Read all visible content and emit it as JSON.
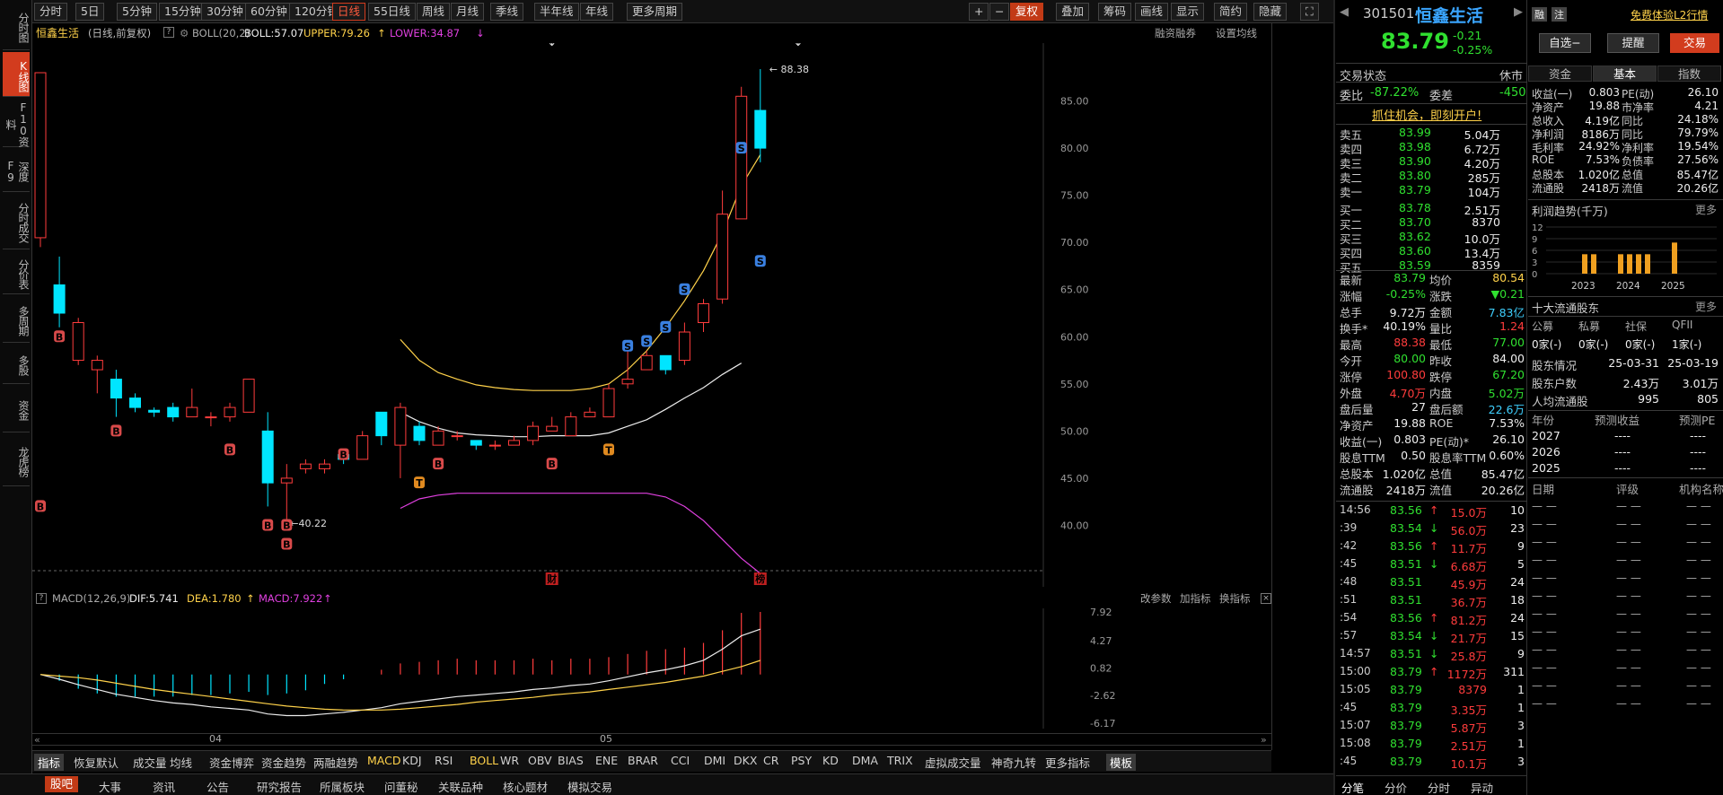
{
  "left_tabs": [
    "分时图",
    "K线图",
    "F10资料",
    "深度F9",
    "分时成交",
    "分价表",
    "多周期",
    "多股",
    "资金",
    "龙虎榜"
  ],
  "toolbar": {
    "periods": [
      "分时",
      "5日",
      "5分钟",
      "15分钟",
      "30分钟",
      "60分钟",
      "120分钟",
      "日线",
      "55日线",
      "周线",
      "月线",
      "季线",
      "半年线",
      "年线",
      "更多周期"
    ],
    "active_period": "日线",
    "right_tools": [
      "+",
      "−",
      "复权",
      "叠加",
      "筹码",
      "画线",
      "显示",
      "简约",
      "隐藏"
    ]
  },
  "chart_header": {
    "name": "恒鑫生活",
    "mode": "(日线,前复权)",
    "indicator": "BOLL(20,2)",
    "boll": "BOLL:57.07",
    "upper": "UPPER:79.26",
    "lower": "LOWER:34.87",
    "links": [
      "融资融券",
      "设置均线"
    ]
  },
  "chart_data": [
    {
      "type": "candlestick",
      "title": "恒鑫生活 日线 前复权",
      "ylim": [
        35,
        90
      ],
      "ticks": [
        40,
        45,
        50,
        55,
        60,
        65,
        70,
        75,
        80,
        85
      ],
      "candles": [
        {
          "o": 70.5,
          "c": 88.0,
          "h": 88.0,
          "l": 69.5
        },
        {
          "o": 65.5,
          "c": 62.5,
          "h": 68.5,
          "l": 61.0
        },
        {
          "o": 57.5,
          "c": 61.5,
          "h": 62.0,
          "l": 57.0
        },
        {
          "o": 56.5,
          "c": 57.5,
          "h": 58.0,
          "l": 54.0
        },
        {
          "o": 55.5,
          "c": 53.5,
          "h": 56.5,
          "l": 51.5
        },
        {
          "o": 53.5,
          "c": 52.5,
          "h": 54.0,
          "l": 52.0
        },
        {
          "o": 52.2,
          "c": 52.0,
          "h": 52.5,
          "l": 51.5
        },
        {
          "o": 52.5,
          "c": 51.5,
          "h": 53.0,
          "l": 51.0
        },
        {
          "o": 51.5,
          "c": 52.5,
          "h": 54.5,
          "l": 51.5
        },
        {
          "o": 51.5,
          "c": 51.5,
          "h": 52.0,
          "l": 50.5
        },
        {
          "o": 51.5,
          "c": 52.5,
          "h": 53.0,
          "l": 51.0
        },
        {
          "o": 52.0,
          "c": 55.5,
          "h": 55.5,
          "l": 52.0
        },
        {
          "o": 50.0,
          "c": 44.5,
          "h": 52.0,
          "l": 42.0
        },
        {
          "o": 44.5,
          "c": 45.0,
          "h": 46.5,
          "l": 40.2
        },
        {
          "o": 46.0,
          "c": 46.5,
          "h": 47.0,
          "l": 45.5
        },
        {
          "o": 46.0,
          "c": 46.5,
          "h": 47.0,
          "l": 45.5
        },
        {
          "o": 47.5,
          "c": 47.0,
          "h": 47.5,
          "l": 46.5
        },
        {
          "o": 47.0,
          "c": 49.5,
          "h": 50.0,
          "l": 47.0
        },
        {
          "o": 52.0,
          "c": 49.5,
          "h": 52.0,
          "l": 48.5
        },
        {
          "o": 48.5,
          "c": 52.5,
          "h": 53.0,
          "l": 45.0
        },
        {
          "o": 50.5,
          "c": 49.0,
          "h": 51.0,
          "l": 48.5
        },
        {
          "o": 48.5,
          "c": 50.0,
          "h": 50.5,
          "l": 48.5
        },
        {
          "o": 49.5,
          "c": 49.5,
          "h": 50.0,
          "l": 49.0
        },
        {
          "o": 49.0,
          "c": 48.5,
          "h": 49.0,
          "l": 48.0
        },
        {
          "o": 48.5,
          "c": 48.5,
          "h": 49.0,
          "l": 48.0
        },
        {
          "o": 48.5,
          "c": 49.0,
          "h": 49.5,
          "l": 48.5
        },
        {
          "o": 49.0,
          "c": 50.5,
          "h": 51.0,
          "l": 48.5
        },
        {
          "o": 50.0,
          "c": 50.5,
          "h": 51.5,
          "l": 50.0
        },
        {
          "o": 49.5,
          "c": 51.5,
          "h": 52.0,
          "l": 49.5
        },
        {
          "o": 51.5,
          "c": 52.0,
          "h": 52.5,
          "l": 51.5
        },
        {
          "o": 51.5,
          "c": 54.5,
          "h": 55.0,
          "l": 51.5
        },
        {
          "o": 55.0,
          "c": 55.5,
          "h": 58.5,
          "l": 54.5
        },
        {
          "o": 56.5,
          "c": 58.0,
          "h": 58.5,
          "l": 56.5
        },
        {
          "o": 58.0,
          "c": 56.5,
          "h": 58.0,
          "l": 56.0
        },
        {
          "o": 57.5,
          "c": 60.5,
          "h": 61.5,
          "l": 57.0
        },
        {
          "o": 61.5,
          "c": 63.5,
          "h": 64.0,
          "l": 60.5
        },
        {
          "o": 64.0,
          "c": 73.0,
          "h": 75.5,
          "l": 63.5
        },
        {
          "o": 72.5,
          "c": 85.5,
          "h": 86.5,
          "l": 72.5
        },
        {
          "o": 84.0,
          "c": 80.0,
          "h": 88.38,
          "l": 78.5
        }
      ],
      "boll_mid": [
        null,
        null,
        null,
        null,
        null,
        null,
        null,
        null,
        null,
        null,
        null,
        null,
        null,
        null,
        null,
        null,
        null,
        null,
        null,
        52.0,
        51.0,
        50.3,
        49.8,
        49.6,
        49.5,
        49.4,
        49.4,
        49.5,
        49.5,
        49.5,
        49.8,
        50.5,
        51.2,
        52.3,
        53.5,
        54.6,
        56.0,
        57.2
      ],
      "boll_upper": [
        null,
        null,
        null,
        null,
        null,
        null,
        null,
        null,
        null,
        null,
        null,
        null,
        null,
        null,
        null,
        null,
        null,
        null,
        null,
        59.7,
        57.5,
        56.2,
        55.5,
        54.9,
        54.6,
        54.4,
        54.3,
        54.3,
        54.3,
        54.5,
        55.0,
        56.5,
        58.5,
        61.0,
        63.8,
        67.0,
        71.0,
        76.0,
        79.3
      ],
      "boll_lower": [
        null,
        null,
        null,
        null,
        null,
        null,
        null,
        null,
        null,
        null,
        null,
        null,
        null,
        null,
        null,
        null,
        null,
        null,
        null,
        41.8,
        42.8,
        43.2,
        43.4,
        43.4,
        43.4,
        43.4,
        43.4,
        43.4,
        43.4,
        43.4,
        43.4,
        43.4,
        43.4,
        43.0,
        42.0,
        40.5,
        38.5,
        36.5,
        34.9
      ],
      "labels": {
        "high": "88.38",
        "low": "40.22"
      },
      "x_ticks": [
        "04",
        "05"
      ],
      "event_marks": [
        "财",
        "榜"
      ]
    },
    {
      "type": "bar",
      "title": "MACD(12,26,9)",
      "ylim": [
        -6.17,
        7.92
      ],
      "ticks": [
        "7.92",
        "4.27",
        "0.82",
        "-2.62",
        "-6.17"
      ],
      "dif": [
        0.0,
        -0.6,
        -1.3,
        -1.9,
        -2.5,
        -2.9,
        -3.3,
        -3.6,
        -3.8,
        -4.1,
        -4.3,
        -4.5,
        -5.0,
        -5.2,
        -5.2,
        -5.0,
        -4.8,
        -4.5,
        -4.2,
        -3.7,
        -3.4,
        -3.1,
        -2.8,
        -2.6,
        -2.4,
        -2.2,
        -1.9,
        -1.7,
        -1.4,
        -1.2,
        -0.8,
        -0.3,
        0.2,
        0.6,
        1.1,
        1.8,
        3.2,
        4.9,
        5.741
      ],
      "dea": [
        0.0,
        -0.2,
        -0.4,
        -0.7,
        -1.1,
        -1.5,
        -1.9,
        -2.2,
        -2.5,
        -2.8,
        -3.1,
        -3.4,
        -3.7,
        -4.0,
        -4.2,
        -4.4,
        -4.5,
        -4.5,
        -4.5,
        -4.4,
        -4.2,
        -4.0,
        -3.8,
        -3.5,
        -3.3,
        -3.1,
        -2.9,
        -2.6,
        -2.4,
        -2.2,
        -1.9,
        -1.6,
        -1.3,
        -1.0,
        -0.6,
        -0.2,
        0.4,
        1.0,
        1.78
      ],
      "hist": [
        0.0,
        -0.8,
        -1.8,
        -2.4,
        -2.8,
        -2.8,
        -2.8,
        -2.8,
        -2.6,
        -2.6,
        -2.4,
        -2.2,
        -2.6,
        -2.4,
        -2.0,
        -1.2,
        -0.6,
        0.0,
        0.6,
        1.4,
        1.6,
        1.8,
        2.0,
        1.8,
        1.8,
        1.8,
        2.0,
        1.8,
        2.0,
        2.0,
        2.2,
        2.6,
        3.0,
        3.2,
        3.4,
        4.0,
        5.6,
        7.8,
        7.922
      ]
    }
  ],
  "macd_header": {
    "indicator": "MACD(12,26,9)",
    "dif": "DIF:5.741",
    "dea": "DEA:1.780",
    "macd": "MACD:7.922",
    "links": [
      "改参数",
      "加指标",
      "换指标"
    ]
  },
  "indicator_tabs": [
    "指标",
    "恢复默认",
    "成交量",
    "均线",
    "资金博弈",
    "资金趋势",
    "两融趋势",
    "MACD",
    "KDJ",
    "RSI",
    "BOLL",
    "WR",
    "OBV",
    "BIAS",
    "ENE",
    "BRAR",
    "CCI",
    "DMI",
    "DKX",
    "CR",
    "PSY",
    "KD",
    "DMA",
    "TRIX",
    "虚拟成交量",
    "神奇九转",
    "更多指标",
    "模板"
  ],
  "footer_tabs": [
    "股吧",
    "大事",
    "资讯",
    "公告",
    "研究报告",
    "所属板块",
    "问董秘",
    "关联品种",
    "核心题材",
    "模拟交易"
  ],
  "stock": {
    "code": "301501",
    "name": "恒鑫生活",
    "price": "83.79",
    "change": "-0.21",
    "change_pct": "-0.25%",
    "actions": [
      "融",
      "注"
    ],
    "l2": "免费体验L2行情",
    "buttons": [
      "自选−",
      "提醒",
      "交易"
    ]
  },
  "trade_status": {
    "label": "交易状态",
    "value": "休市"
  },
  "commission": {
    "ratio_label": "委比",
    "ratio": "-87.22%",
    "diff_label": "委差",
    "diff": "-450"
  },
  "promo": "抓住机会，即刻开户!",
  "asks": [
    [
      "卖五",
      "83.99",
      "5.04万"
    ],
    [
      "卖四",
      "83.98",
      "6.72万"
    ],
    [
      "卖三",
      "83.90",
      "4.20万"
    ],
    [
      "卖二",
      "83.80",
      "285万"
    ],
    [
      "卖一",
      "83.79",
      "104万"
    ]
  ],
  "bids": [
    [
      "买一",
      "83.78",
      "2.51万"
    ],
    [
      "买二",
      "83.70",
      "8370"
    ],
    [
      "买三",
      "83.62",
      "10.0万"
    ],
    [
      "买四",
      "83.60",
      "13.4万"
    ],
    [
      "买五",
      "83.59",
      "8359"
    ]
  ],
  "quote": [
    [
      "最新",
      "83.79",
      "均价",
      "80.54"
    ],
    [
      "涨幅",
      "-0.25%",
      "涨跌",
      "▼0.21"
    ],
    [
      "总手",
      "9.72万",
      "金额",
      "7.83亿"
    ],
    [
      "换手*",
      "40.19%",
      "量比",
      "1.24"
    ],
    [
      "最高",
      "88.38",
      "最低",
      "77.00"
    ],
    [
      "今开",
      "80.00",
      "昨收",
      "84.00"
    ],
    [
      "涨停",
      "100.80",
      "跌停",
      "67.20"
    ],
    [
      "外盘",
      "4.70万",
      "内盘",
      "5.02万"
    ],
    [
      "盘后量",
      "27",
      "盘后额",
      "22.6万"
    ],
    [
      "净资产",
      "19.88",
      "ROE",
      "7.53%"
    ],
    [
      "收益(一)",
      "0.803",
      "PE(动)*",
      "26.10"
    ],
    [
      "股息TTM",
      "0.50",
      "股息率TTM",
      "0.60%"
    ],
    [
      "总股本",
      "1.020亿",
      "总值",
      "85.47亿"
    ],
    [
      "流通股",
      "2418万",
      "流值",
      "20.26亿"
    ]
  ],
  "ticks": [
    [
      "14:56",
      "83.56",
      "↑",
      "15.0万",
      "10"
    ],
    [
      ":39",
      "83.54",
      "↓",
      "56.0万",
      "23"
    ],
    [
      ":42",
      "83.56",
      "↑",
      "11.7万",
      "9"
    ],
    [
      ":45",
      "83.51",
      "↓",
      "6.68万",
      "5"
    ],
    [
      ":48",
      "83.51",
      "",
      "45.9万",
      "24"
    ],
    [
      ":51",
      "83.51",
      "",
      "36.7万",
      "18"
    ],
    [
      ":54",
      "83.56",
      "↑",
      "81.2万",
      "24"
    ],
    [
      ":57",
      "83.54",
      "↓",
      "21.7万",
      "15"
    ],
    [
      "14:57",
      "83.51",
      "↓",
      "25.8万",
      "9"
    ],
    [
      "15:00",
      "83.79",
      "↑",
      "1172万",
      "311"
    ],
    [
      "15:05",
      "83.79",
      "",
      "8379",
      "1"
    ],
    [
      ":45",
      "83.79",
      "",
      "3.35万",
      "1"
    ],
    [
      "15:07",
      "83.79",
      "",
      "5.87万",
      "3"
    ],
    [
      "15:08",
      "83.79",
      "",
      "2.51万",
      "1"
    ],
    [
      ":45",
      "83.79",
      "",
      "10.1万",
      "3"
    ]
  ],
  "tick_tabs": [
    "分笔",
    "分价",
    "分时",
    "异动"
  ],
  "fund_tabs": [
    "资金",
    "基本",
    "指数"
  ],
  "fundamentals": [
    [
      "收益(一)",
      "0.803",
      "PE(动)",
      "26.10"
    ],
    [
      "净资产",
      "19.88",
      "市净率",
      "4.21"
    ],
    [
      "总收入",
      "4.19亿",
      "同比",
      "24.18%"
    ],
    [
      "净利润",
      "8186万",
      "同比",
      "79.79%"
    ],
    [
      "毛利率",
      "24.92%",
      "净利率",
      "19.54%"
    ],
    [
      "ROE",
      "7.53%",
      "负债率",
      "27.56%"
    ],
    [
      "总股本",
      "1.020亿",
      "总值",
      "85.47亿"
    ],
    [
      "流通股",
      "2418万",
      "流值",
      "20.26亿"
    ]
  ],
  "profit": {
    "title": "利润趋势(千万)",
    "more": "更多",
    "yticks": [
      "12",
      "9",
      "6",
      "3",
      "0"
    ],
    "years": [
      "2023",
      "2024",
      "2025"
    ],
    "values": [
      0,
      0,
      5,
      5,
      0,
      0,
      5,
      5,
      5,
      5,
      0,
      0,
      8
    ]
  },
  "holders": {
    "title": "十大流通股东",
    "more": "更多",
    "types": [
      "公募",
      "私募",
      "社保",
      "QFII"
    ],
    "counts": [
      "0家(-)",
      "0家(-)",
      "0家(-)",
      "1家(-)"
    ],
    "info": [
      [
        "股东情况",
        "25-03-31",
        "25-03-19"
      ],
      [
        "股东户数",
        "2.43万",
        "3.01万"
      ],
      [
        "人均流通股",
        "995",
        "805"
      ]
    ]
  },
  "forecast": {
    "headers": [
      "年份",
      "预测收益",
      "预测PE"
    ],
    "rows": [
      [
        "2027",
        "----",
        "----"
      ],
      [
        "2026",
        "----",
        "----"
      ],
      [
        "2025",
        "----",
        "----"
      ]
    ]
  },
  "ratings": {
    "headers": [
      "日期",
      "评级",
      "机构名称"
    ],
    "dash": "— —",
    "count": 12
  }
}
